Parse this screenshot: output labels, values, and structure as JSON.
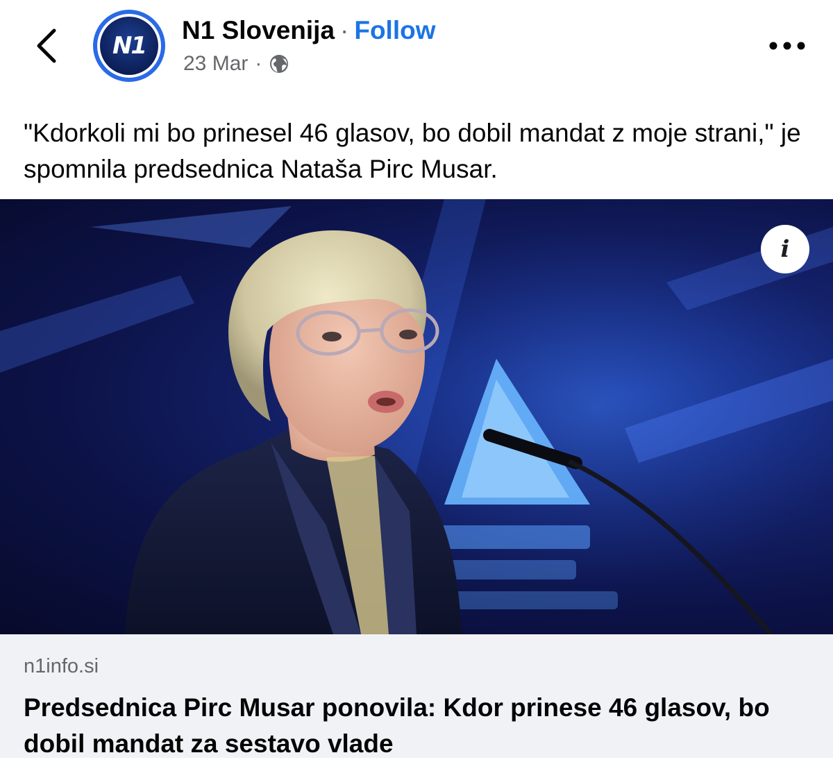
{
  "header": {
    "page_name": "N1 Slovenija",
    "separator": "·",
    "follow_label": "Follow",
    "date": "23 Mar",
    "meta_dot": "·",
    "avatar_text": "N1"
  },
  "post": {
    "caption": "\"Kdorkoli mi bo prinesel 46 glasov, bo dobil mandat z moje strani,\" je spomnila predsednica Nataša Pirc Musar."
  },
  "photo": {
    "info_label": "i"
  },
  "link_card": {
    "domain": "n1info.si",
    "headline": "Predsednica Pirc Musar ponovila: Kdor prinese 46 glasov, bo dobil mandat za sestavo vlade"
  },
  "icons": {
    "back": "chevron-left-icon",
    "globe": "globe-icon",
    "more": "more-horizontal-icon",
    "info": "info-icon"
  },
  "colors": {
    "accent": "#1b74e4",
    "secondary_text": "#65676b",
    "card_bg": "#f0f2f5"
  }
}
